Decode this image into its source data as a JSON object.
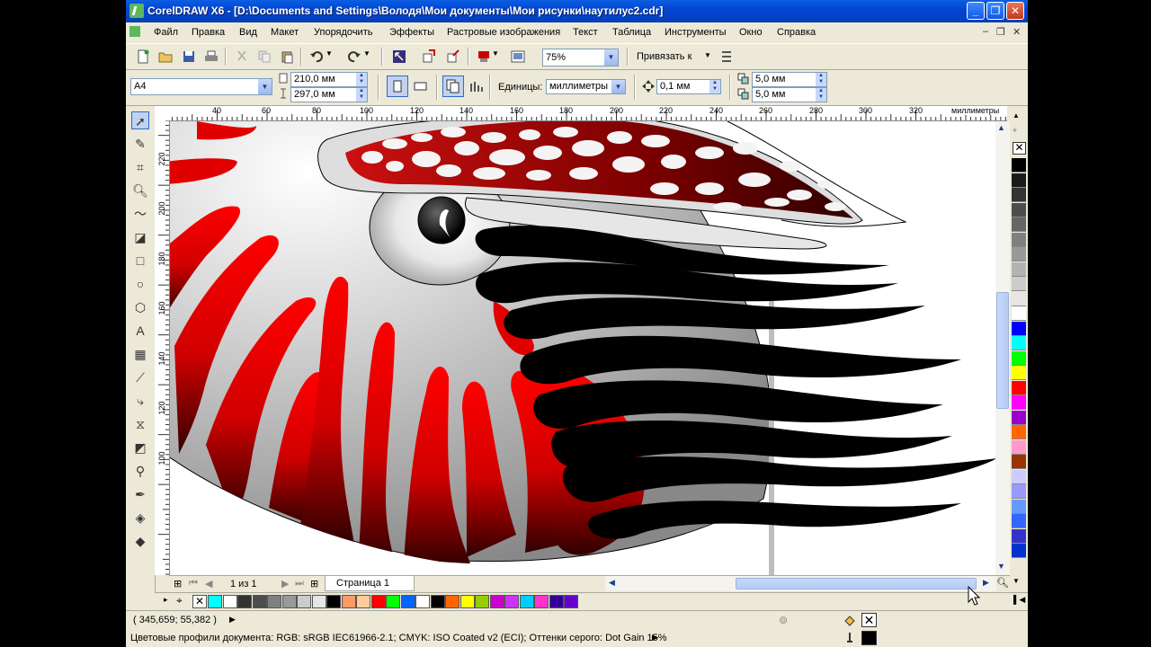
{
  "window": {
    "title": "CorelDRAW X6 - [D:\\Documents and Settings\\Володя\\Мои документы\\Мои рисунки\\наутилус2.cdr]"
  },
  "menu": [
    "Файл",
    "Правка",
    "Вид",
    "Макет",
    "Упорядочить",
    "Эффекты",
    "Растровые изображения",
    "Текст",
    "Таблица",
    "Инструменты",
    "Окно",
    "Справка"
  ],
  "toolbar": {
    "zoom": "75%",
    "snap_label": "Привязать к"
  },
  "property_bar": {
    "page_size": "A4",
    "width": "210,0 мм",
    "height": "297,0 мм",
    "units_label": "Единицы:",
    "units_value": "миллиметры",
    "nudge": "0,1 мм",
    "dup_x": "5,0 мм",
    "dup_y": "5,0 мм"
  },
  "ruler": {
    "h_ticks": [
      "40",
      "60",
      "80",
      "100",
      "120",
      "140",
      "160",
      "180",
      "200",
      "220",
      "240",
      "260",
      "280",
      "300",
      "320"
    ],
    "h_unit": "миллиметры",
    "v_ticks": [
      "220",
      "200",
      "180",
      "160",
      "140",
      "120",
      "100"
    ],
    "v_unit": "миллиметры"
  },
  "page_nav": {
    "counter": "1 из 1",
    "tab": "Страница 1"
  },
  "status": {
    "coords": "( 345,659; 55,382 )",
    "profiles": "Цветовые профили документа: RGB: sRGB IEC61966-2.1; CMYK: ISO Coated v2 (ECI); Оттенки серого: Dot Gain 15%"
  },
  "colors": {
    "palette_right": [
      "#000000",
      "#1A1A1A",
      "#333333",
      "#4D4D4D",
      "#666666",
      "#808080",
      "#999999",
      "#B3B3B3",
      "#CCCCCC",
      "#E6E6E6",
      "#FFFFFF",
      "#0000FF",
      "#00FFFF",
      "#00FF00",
      "#FFFF00",
      "#FF0000",
      "#FF00FF",
      "#9900CC",
      "#FF6600",
      "#FF99CC",
      "#993300",
      "#CCCCFF",
      "#9999FF",
      "#6699FF",
      "#3366FF",
      "#3333CC",
      "#0033CC"
    ],
    "palette_doc": [
      "#00FFFF",
      "#FFFFFF",
      "#333333",
      "#4D4D4D",
      "#808080",
      "#999999",
      "#CCCCCC",
      "#E6E6E6",
      "#000000",
      "#FF9966",
      "#FFCC99",
      "#FF0000",
      "#00FF00",
      "#0066FF",
      "#FFFFFF",
      "#000000",
      "#FF6600",
      "#FFFF00",
      "#99CC00",
      "#CC00CC",
      "#CC33FF",
      "#00CCFF",
      "#FF33CC",
      "#330099",
      "#6600CC"
    ],
    "accent_red": "#E00000"
  }
}
